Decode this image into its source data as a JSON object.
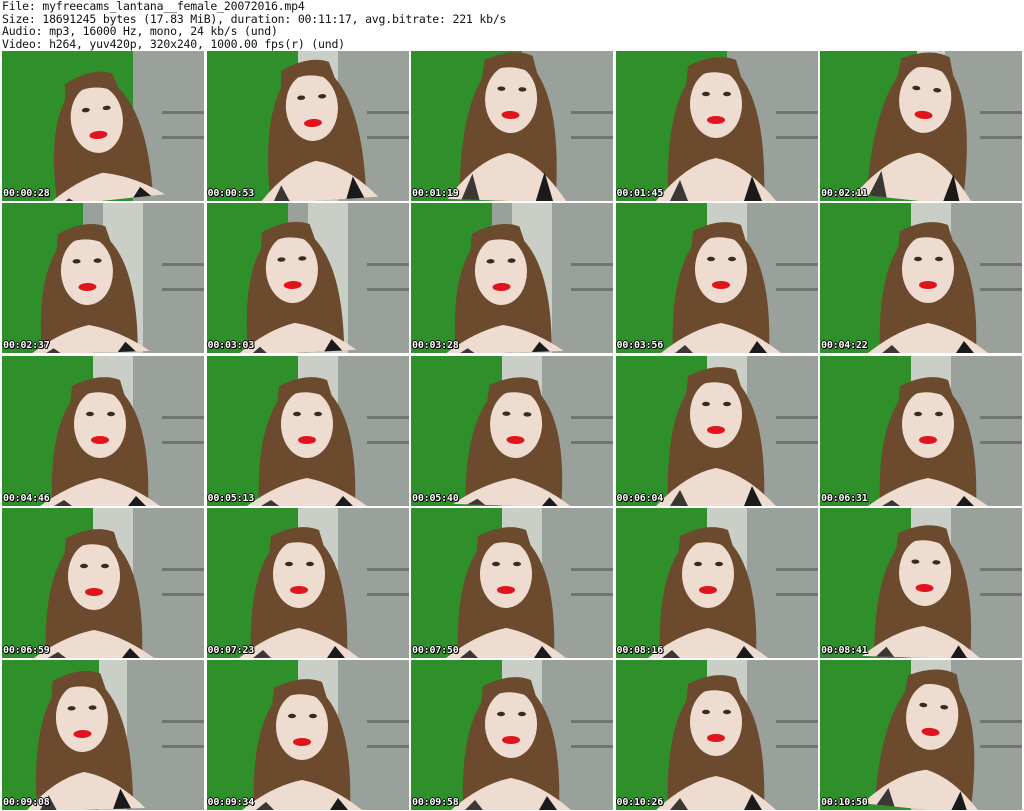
{
  "header": {
    "file_line": "File: myfreecams_lantana__female_20072016.mp4",
    "size_line": "Size: 18691245 bytes (17.83 MiB), duration: 00:11:17, avg.bitrate: 221 kb/s",
    "audio_line": "Audio: mp3, 16000 Hz, mono, 24 kb/s (und)",
    "video_line": "Video: h264, yuv420p, 320x240, 1000.00 fps(r) (und)"
  },
  "frames": [
    {
      "timestamp": "00:00:28"
    },
    {
      "timestamp": "00:00:53"
    },
    {
      "timestamp": "00:01:19"
    },
    {
      "timestamp": "00:01:45"
    },
    {
      "timestamp": "00:02:11"
    },
    {
      "timestamp": "00:02:37"
    },
    {
      "timestamp": "00:03:03"
    },
    {
      "timestamp": "00:03:28"
    },
    {
      "timestamp": "00:03:56"
    },
    {
      "timestamp": "00:04:22"
    },
    {
      "timestamp": "00:04:46"
    },
    {
      "timestamp": "00:05:13"
    },
    {
      "timestamp": "00:05:40"
    },
    {
      "timestamp": "00:06:04"
    },
    {
      "timestamp": "00:06:31"
    },
    {
      "timestamp": "00:06:59"
    },
    {
      "timestamp": "00:07:23"
    },
    {
      "timestamp": "00:07:50"
    },
    {
      "timestamp": "00:08:16"
    },
    {
      "timestamp": "00:08:41"
    },
    {
      "timestamp": "00:09:08"
    },
    {
      "timestamp": "00:09:34"
    },
    {
      "timestamp": "00:09:58"
    },
    {
      "timestamp": "00:10:26"
    },
    {
      "timestamp": "00:10:50"
    }
  ],
  "colors": {
    "wall_green": "#2f8f2a",
    "room_gray": "#9aa19a",
    "skin": "#efdcd0",
    "hair": "#6b4a2e",
    "lips": "#e0141c",
    "top_black": "#1a1a1a"
  }
}
